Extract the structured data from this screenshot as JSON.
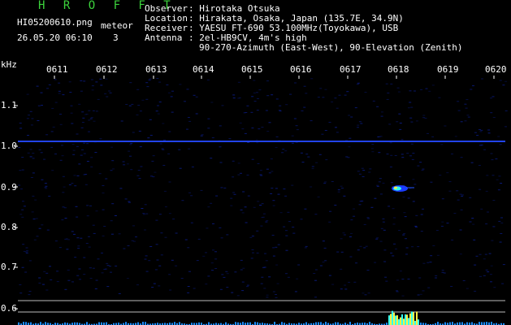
{
  "header": {
    "app_title": "H R O F F T",
    "filename": "HI05200610.png",
    "datetime": "26.05.20 06:10",
    "meteor_label": "meteor",
    "meteor_count": "3",
    "info_labels": [
      "Observer",
      "Location",
      "Receiver",
      "Antenna"
    ],
    "info_values": [
      ": Hirotaka Otsuka",
      ": Hirakata, Osaka, Japan (135.7E, 34.9N)",
      ": YAESU FT-690 53.100MHz(Toyokawa), USB",
      ": 2el-HB9CV, 4m's high"
    ],
    "antenna_line2": "90-270-Azimuth (East-West), 90-Elevation (Zenith)"
  },
  "axes": {
    "y_unit": "kHz",
    "time_labels": [
      "0611",
      "0612",
      "0613",
      "0614",
      "0615",
      "0616",
      "0617",
      "0618",
      "0619",
      "0620"
    ],
    "freq_labels": [
      "1.1",
      "1.0",
      "0.9",
      "0.8",
      "0.7",
      "0.6"
    ]
  },
  "colors": {
    "title": "#3cd23c",
    "background": "#000000",
    "noise": "#0a1a7a",
    "carrier": "#2244ee",
    "meteor": "#33ffee",
    "text": "#ffffff"
  }
}
